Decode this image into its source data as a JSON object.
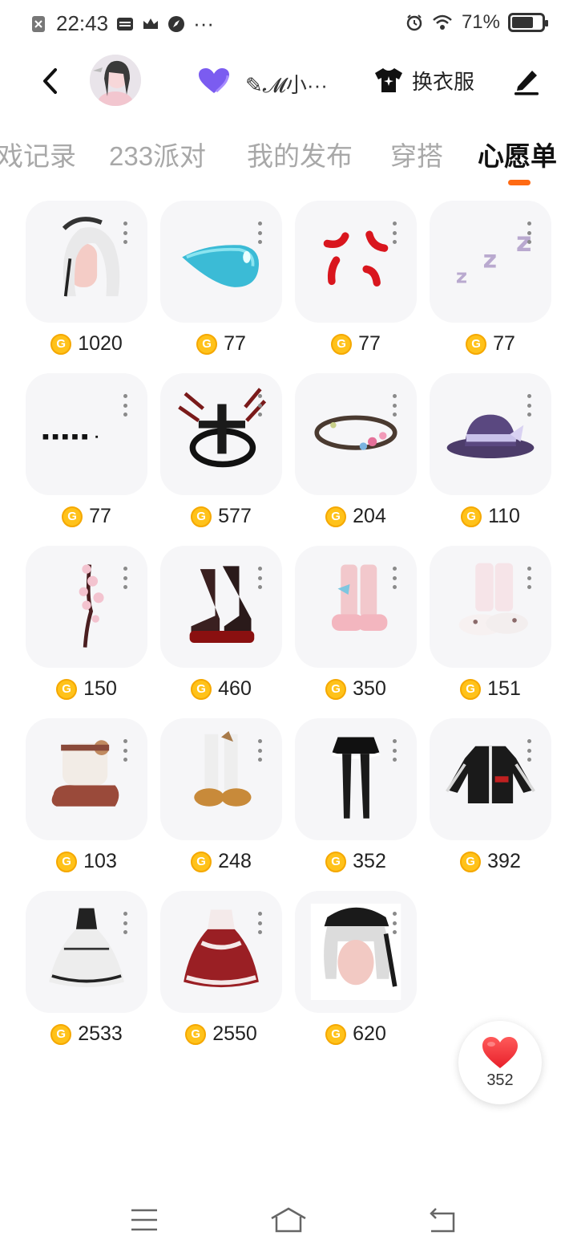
{
  "status_bar": {
    "time": "22:43",
    "left_icons": [
      "sim-off-icon",
      "card-icon",
      "crown-icon",
      "compass-icon"
    ],
    "more": "···",
    "right_icons": [
      "alarm-icon",
      "wifi-icon"
    ],
    "battery": "71%",
    "battery_level": 0.71
  },
  "header": {
    "back_icon": "back-arrow-icon",
    "heart_icon": "purple-heart-icon",
    "nickname": "✎𝓜小···",
    "outfit_label": "换衣服",
    "outfit_icon": "shirt-icon",
    "edit_icon": "pencil-icon"
  },
  "tabs": [
    {
      "label": "戏记录"
    },
    {
      "label": "233派对"
    },
    {
      "label": "我的发布"
    },
    {
      "label": "穿搭"
    },
    {
      "label": "心愿单"
    }
  ],
  "active_tab": 4,
  "accent_color": "#ff6a13",
  "items": [
    {
      "name": "white-hair-wig",
      "price": "1020"
    },
    {
      "name": "blue-drop-emote",
      "price": "77"
    },
    {
      "name": "angry-mark-emote",
      "price": "77"
    },
    {
      "name": "zzz-sleep-emote",
      "price": "77"
    },
    {
      "name": "dots-emote",
      "price": "77"
    },
    {
      "name": "cross-halo-ornament",
      "price": "577"
    },
    {
      "name": "flower-thorn-crown",
      "price": "204"
    },
    {
      "name": "purple-bow-hat",
      "price": "110"
    },
    {
      "name": "sakura-branch",
      "price": "150"
    },
    {
      "name": "red-black-platform-boots",
      "price": "460"
    },
    {
      "name": "pink-bow-boots",
      "price": "350"
    },
    {
      "name": "pink-bunny-boots",
      "price": "151"
    },
    {
      "name": "teddy-fur-boots",
      "price": "103"
    },
    {
      "name": "white-lace-boots",
      "price": "248"
    },
    {
      "name": "black-skirt-leggings",
      "price": "352"
    },
    {
      "name": "racing-jacket",
      "price": "392"
    },
    {
      "name": "gothic-lolita-dress",
      "price": "2533"
    },
    {
      "name": "red-white-lolita-dress",
      "price": "2550"
    },
    {
      "name": "maid-twin-tail-wig",
      "price": "620"
    }
  ],
  "coin_symbol": "G",
  "like_fab": {
    "icon": "heart-icon",
    "count": "352"
  },
  "nav": [
    "menu-icon",
    "home-icon",
    "back-icon"
  ]
}
